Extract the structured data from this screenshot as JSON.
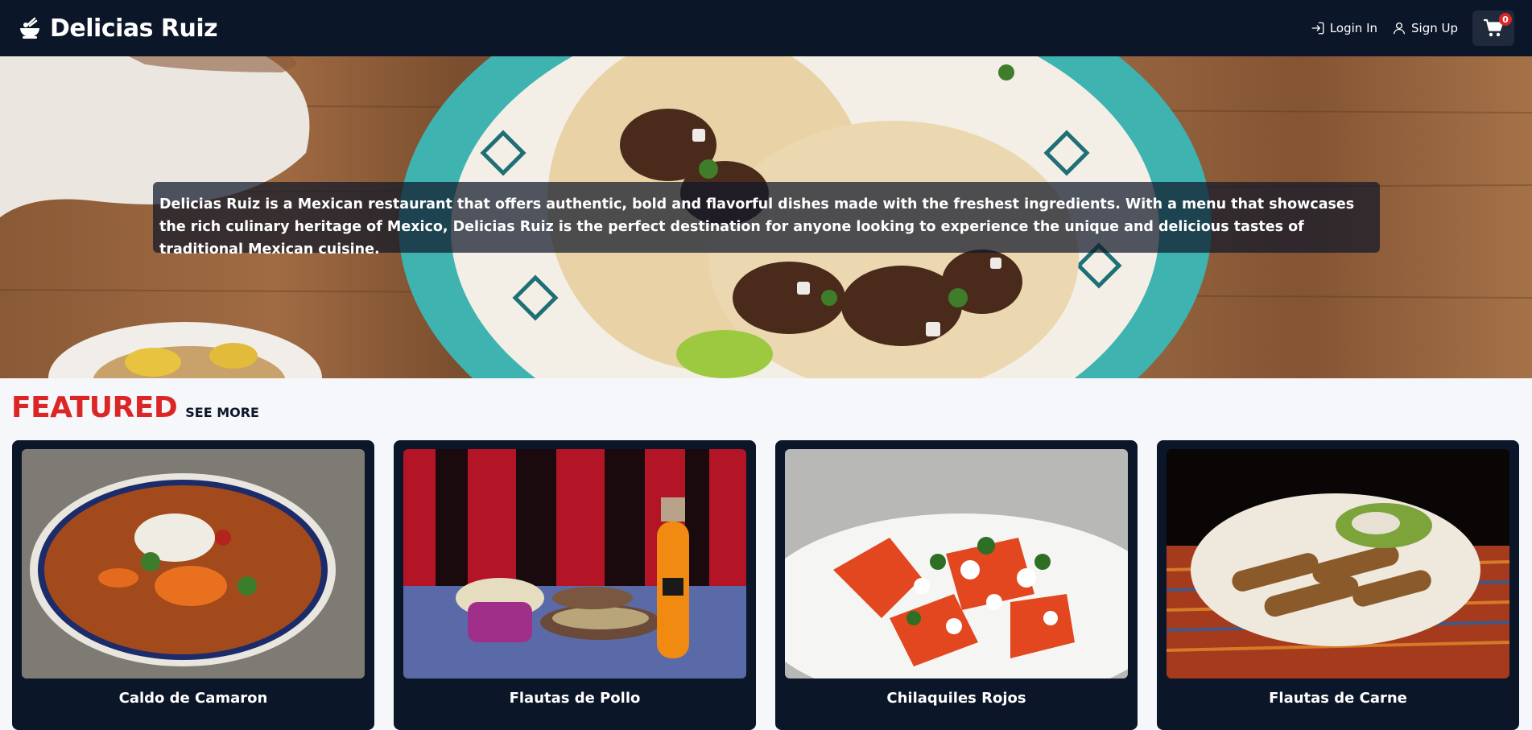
{
  "header": {
    "brand_name": "Delicias Ruiz",
    "login_label": "Login In",
    "signup_label": "Sign Up",
    "cart_count": "0"
  },
  "hero": {
    "caption": "Delicias Ruiz is a Mexican restaurant that offers authentic, bold and flavorful dishes made with the freshest ingredients. With a menu that showcases the rich culinary heritage of Mexico, Delicias Ruiz is the perfect destination for anyone looking to experience the unique and delicious tastes of traditional Mexican cuisine."
  },
  "featured": {
    "title": "FEATURED",
    "see_more": "SEE MORE",
    "items": [
      {
        "name": "Caldo de Camaron"
      },
      {
        "name": "Flautas de Pollo"
      },
      {
        "name": "Chilaquiles Rojos"
      },
      {
        "name": "Flautas de Carne"
      }
    ]
  },
  "colors": {
    "navbar": "#0c1629",
    "accent_red": "#dc2626",
    "page_bg": "#f5f7fa"
  },
  "icons": [
    "bowl-logo-icon",
    "login-icon",
    "user-icon",
    "cart-icon"
  ]
}
